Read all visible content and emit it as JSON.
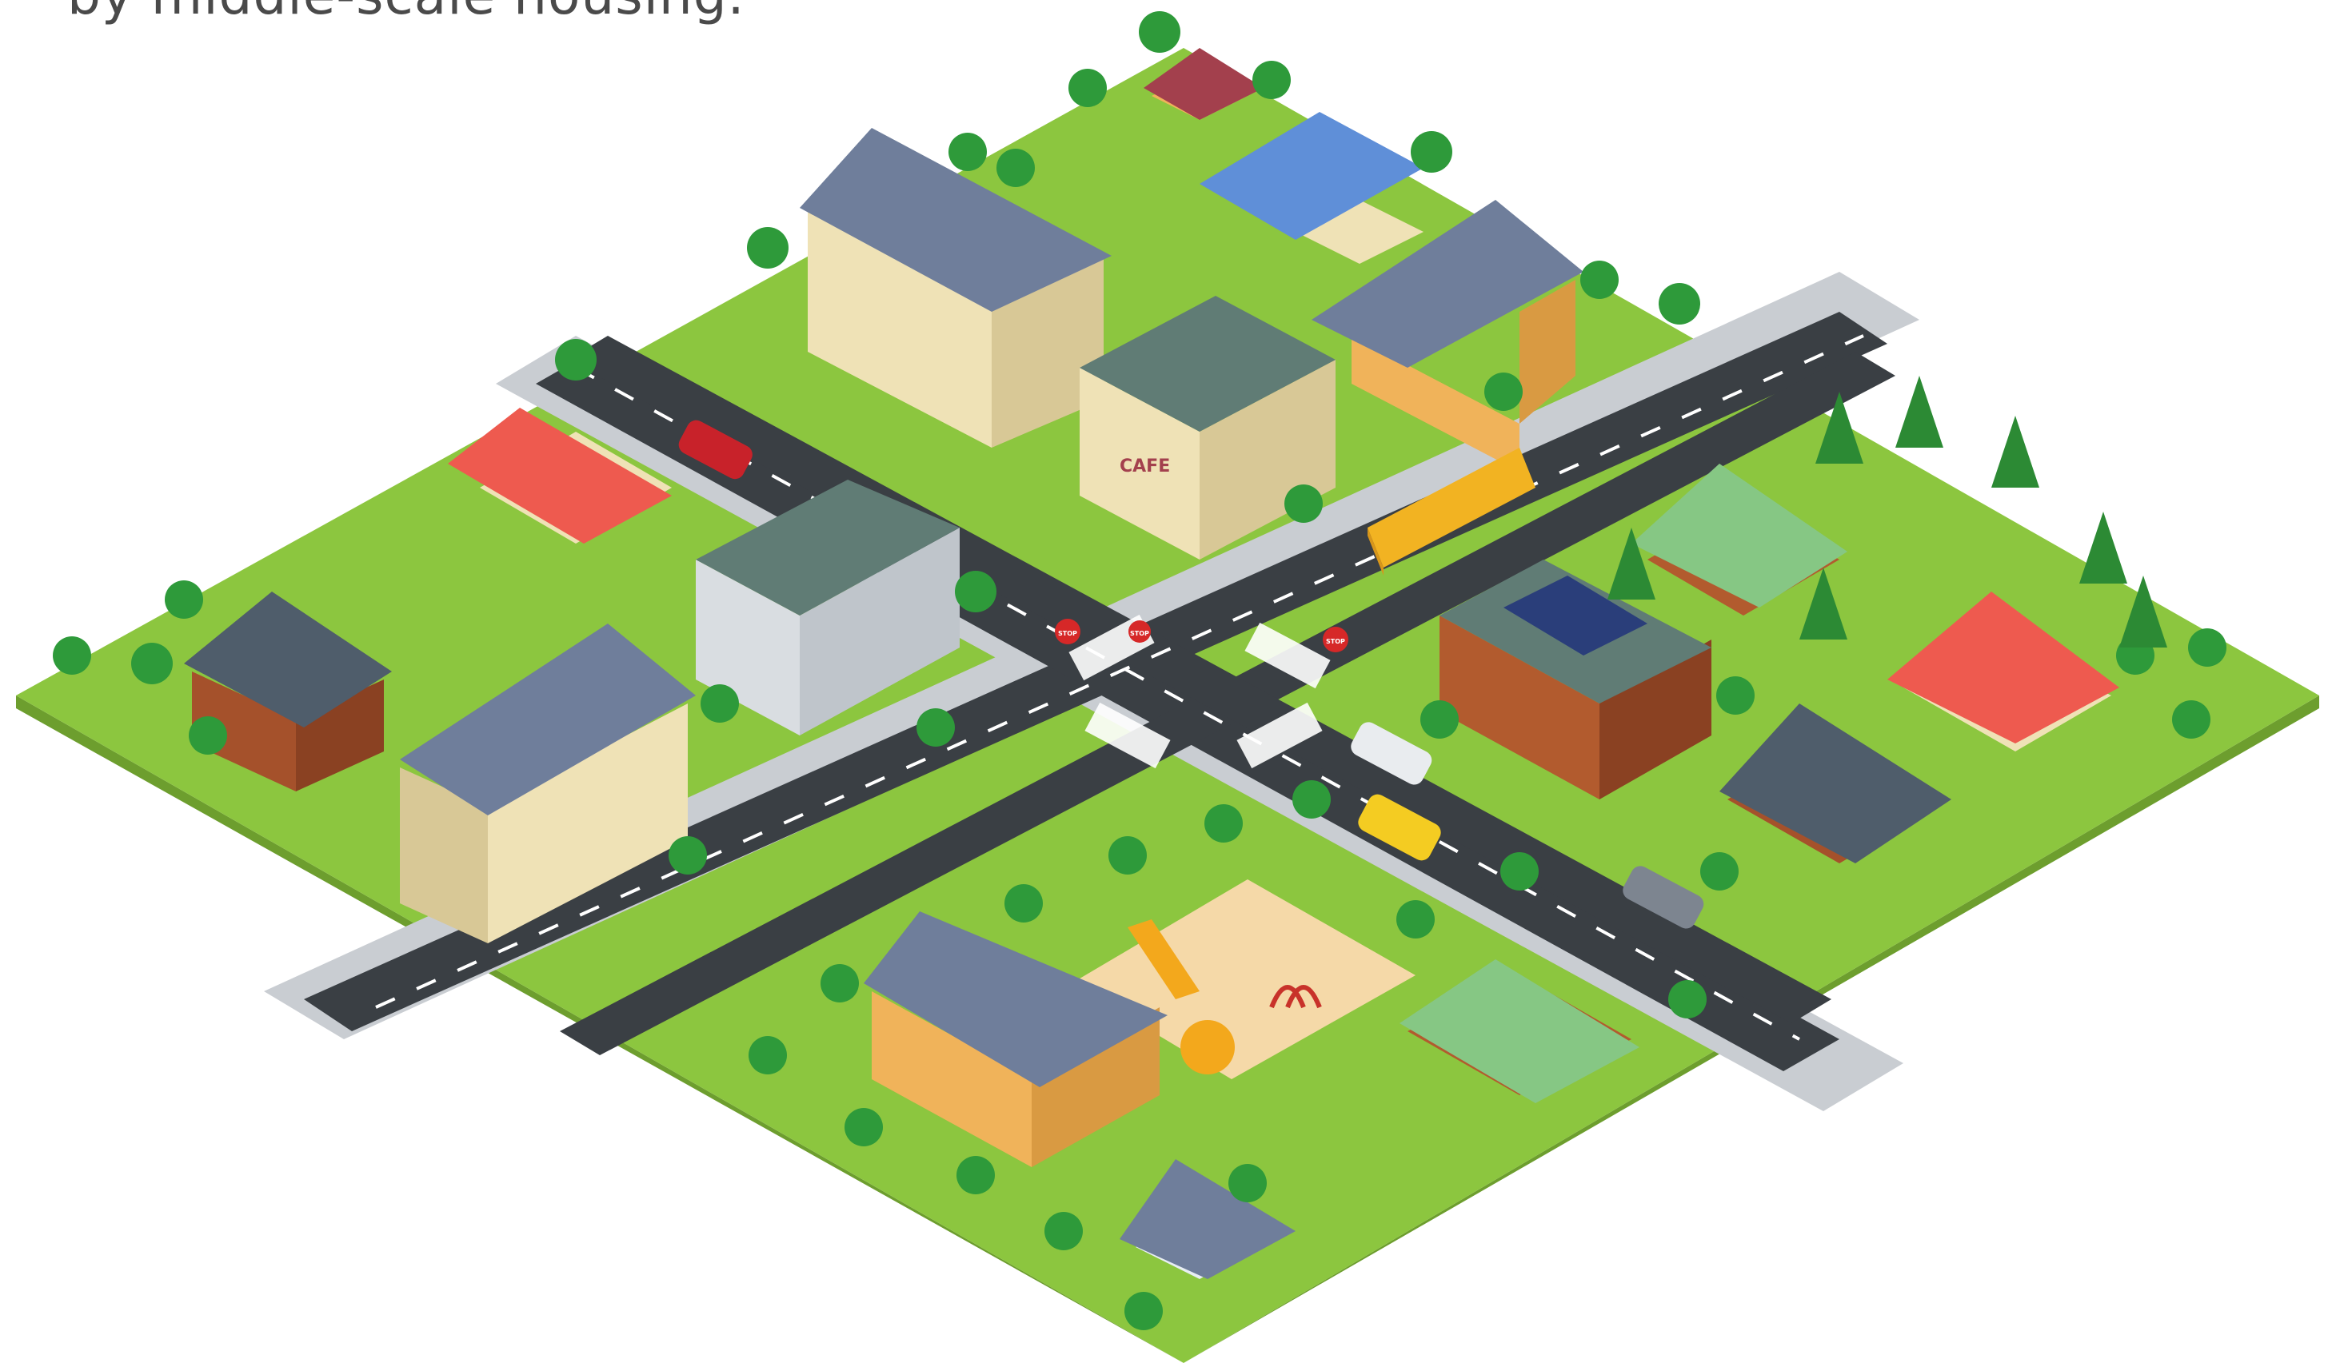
{
  "caption": {
    "text": "by middle-scale housing."
  },
  "signs": {
    "cafe": "CAFE",
    "stop_1": "STOP",
    "stop_2": "STOP",
    "stop_3": "STOP"
  },
  "colors": {
    "grass": "#8cc63f",
    "road": "#3a3f44",
    "sidewalk": "#c9cdd2",
    "roof_slate": "#6f7e9b",
    "roof_red": "#ee5a4f",
    "roof_green": "#86c784",
    "wall_cream": "#efe2b6",
    "wall_orange": "#f0b35a",
    "bus": "#f2b322",
    "tree": "#2e9a3a"
  }
}
